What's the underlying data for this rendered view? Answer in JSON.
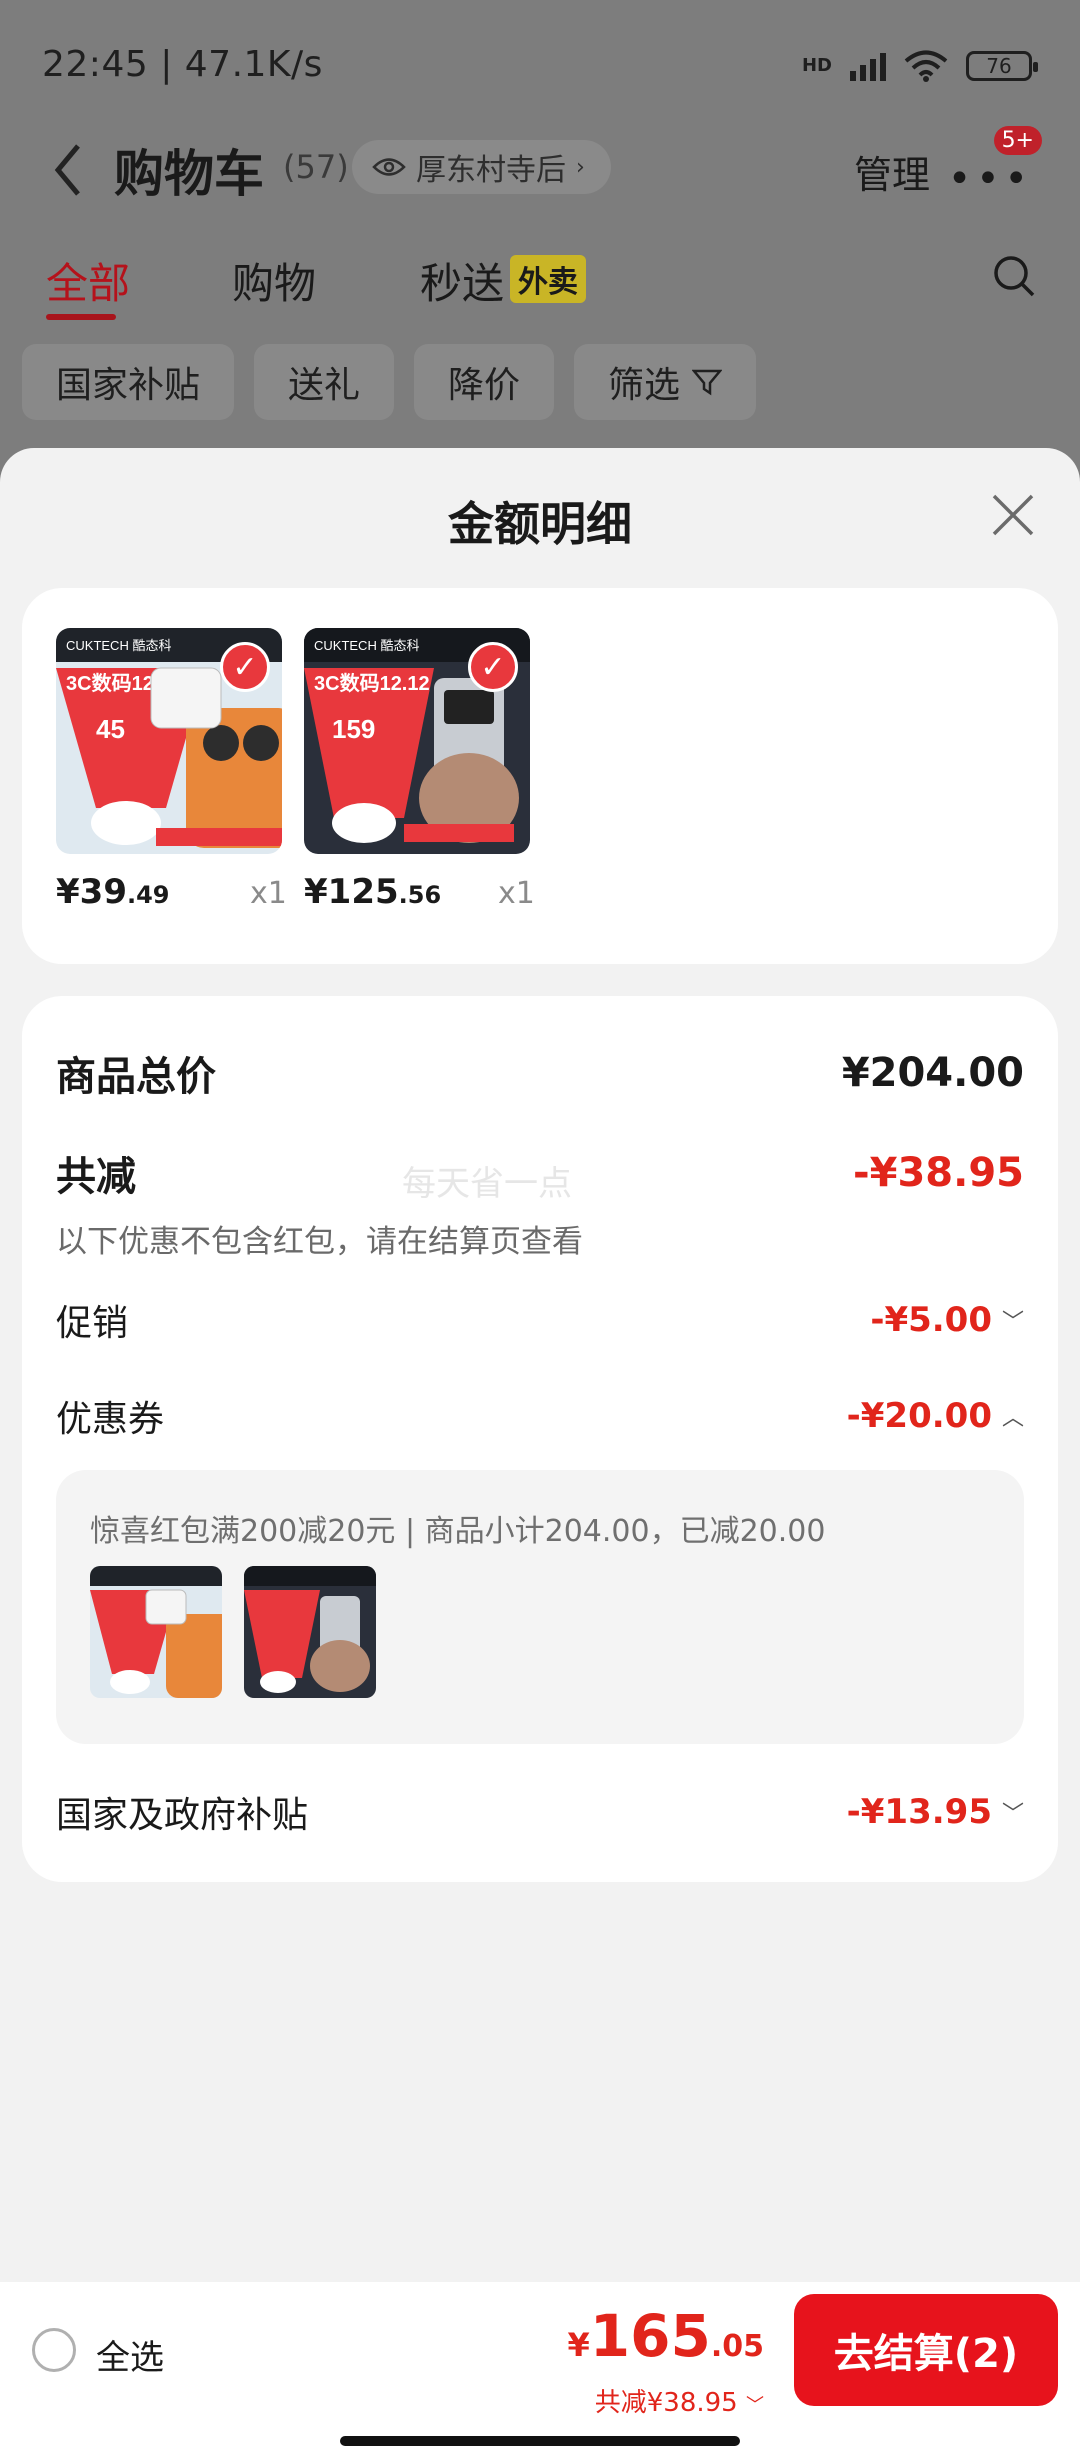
{
  "status_bar": {
    "time_speed": "22:45 | 47.1K/s",
    "network": "HD",
    "battery": "76"
  },
  "navbar": {
    "back_icon": "chevron-left-icon",
    "title": "购物车",
    "count": "(57)",
    "location": "厚东村寺后",
    "manage": "管理",
    "badge": "5+"
  },
  "tabs": [
    {
      "label": "全部"
    },
    {
      "label": "购物"
    },
    {
      "label": "秒送",
      "tag": "外卖"
    }
  ],
  "filters": [
    "国家补贴",
    "送礼",
    "降价",
    "筛选"
  ],
  "sheet": {
    "title": "金额明细",
    "products": [
      {
        "price_int": "¥39",
        "price_dec": ".49",
        "qty": "x1",
        "brand": "CUKTECH 酷态科",
        "promo": "3C数码12.12",
        "thumb_price": "45",
        "thumb_color": "#e8873a"
      },
      {
        "price_int": "¥125",
        "price_dec": ".56",
        "qty": "x1",
        "brand": "CUKTECH 酷态科",
        "promo": "3C数码12.12",
        "thumb_price": "159",
        "thumb_color": "#2a2f3a"
      }
    ],
    "total_label": "商品总价",
    "total_value": "¥204.00",
    "reduce_label": "共减",
    "reduce_value": "-¥38.95",
    "watermark": "每天省一点",
    "hint": "以下优惠不包含红包，请在结算页查看",
    "promo_label": "促销",
    "promo_value": "-¥5.00",
    "coupon_label": "优惠券",
    "coupon_value": "-¥20.00",
    "coupon_detail": "惊喜红包满200减20元 | 商品小计204.00，已减20.00",
    "subsidy_label": "国家及政府补贴",
    "subsidy_value": "-¥13.95"
  },
  "bottom": {
    "select_all": "全选",
    "currency": "¥",
    "total_int": "165",
    "total_dec": ".05",
    "saved": "共减¥38.95",
    "checkout": "去结算(2)"
  },
  "colors": {
    "accent_red": "#e1251b",
    "checkout_red": "#e7131c",
    "tab_red": "#b5121b"
  }
}
